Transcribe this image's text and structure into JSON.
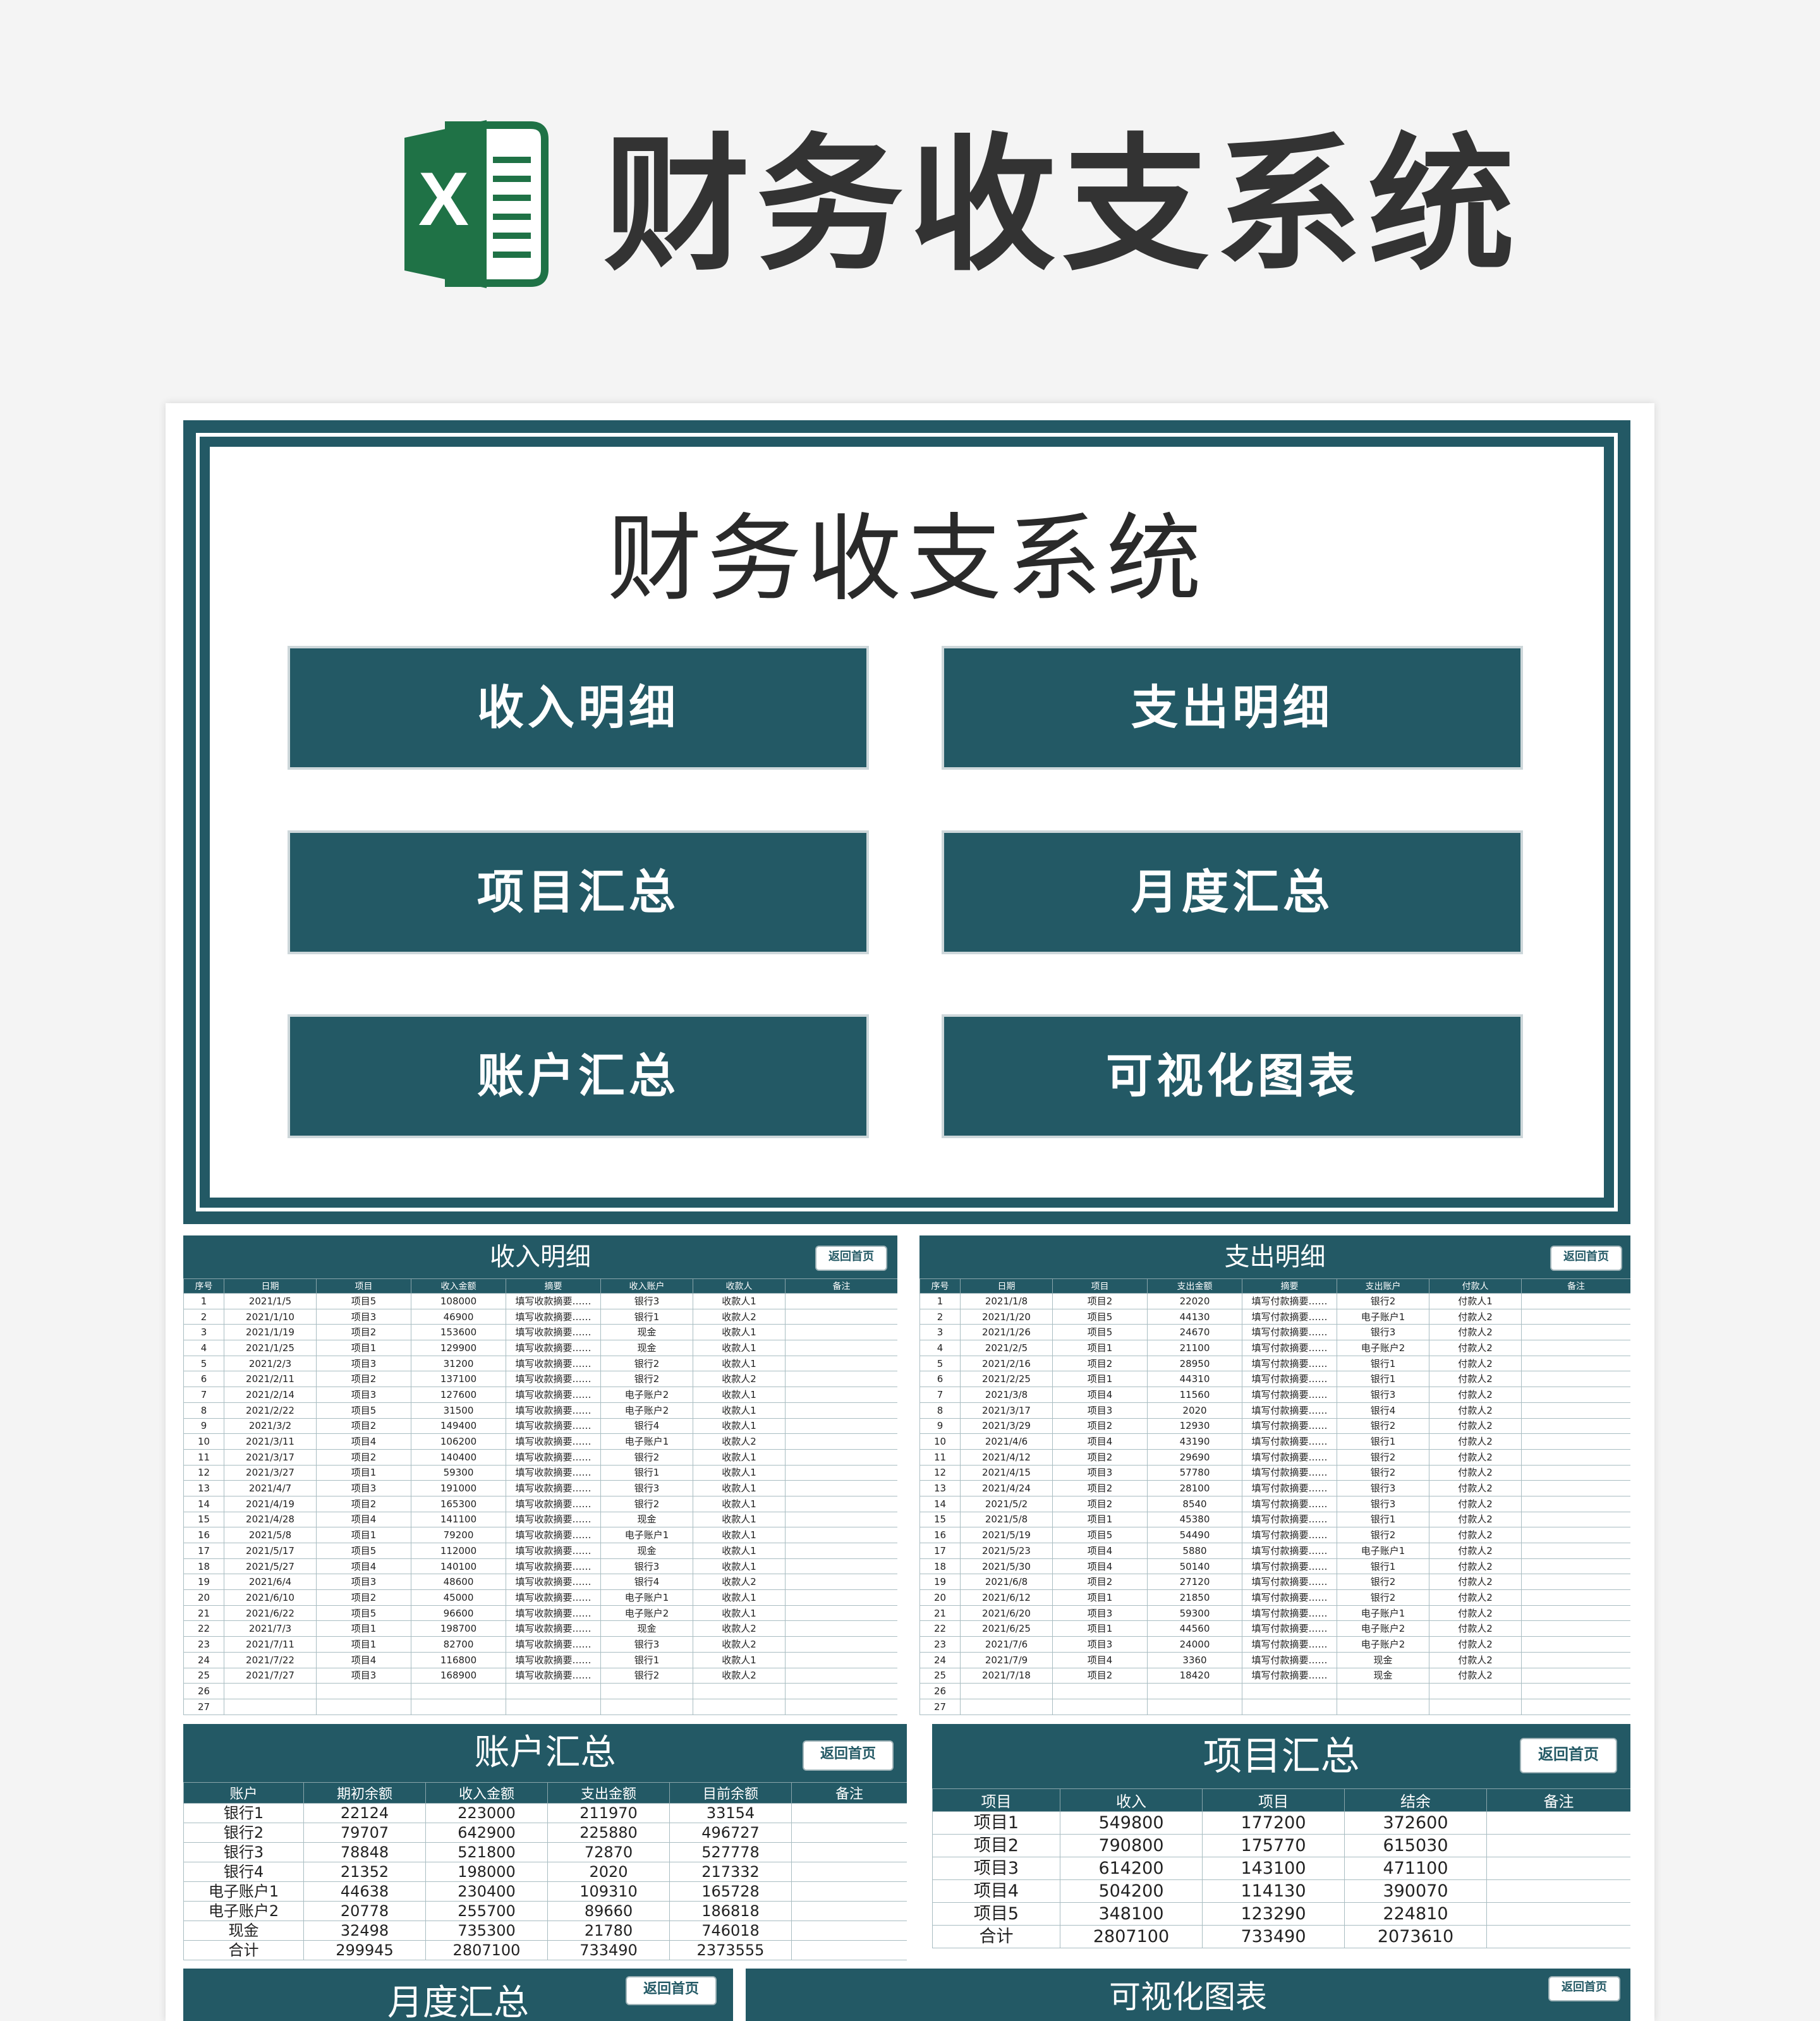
{
  "header": {
    "title": "财务收支系统",
    "logo_letter": "X"
  },
  "home": {
    "title": "财务收支系统",
    "buttons": {
      "income": "收入明细",
      "expense": "支出明细",
      "project": "项目汇总",
      "monthly": "月度汇总",
      "account": "账户汇总",
      "chart": "可视化图表"
    }
  },
  "back_label": "返回首页",
  "income": {
    "title": "收入明细",
    "columns": [
      "序号",
      "日期",
      "项目",
      "收入金额",
      "摘要",
      "收入账户",
      "收款人",
      "备注"
    ],
    "rows": [
      [
        "1",
        "2021/1/5",
        "项目5",
        "108000",
        "填写收款摘要……",
        "银行3",
        "收款人1",
        ""
      ],
      [
        "2",
        "2021/1/10",
        "项目3",
        "46900",
        "填写收款摘要……",
        "银行1",
        "收款人2",
        ""
      ],
      [
        "3",
        "2021/1/19",
        "项目2",
        "153600",
        "填写收款摘要……",
        "现金",
        "收款人1",
        ""
      ],
      [
        "4",
        "2021/1/25",
        "项目1",
        "129900",
        "填写收款摘要……",
        "现金",
        "收款人1",
        ""
      ],
      [
        "5",
        "2021/2/3",
        "项目3",
        "31200",
        "填写收款摘要……",
        "银行2",
        "收款人1",
        ""
      ],
      [
        "6",
        "2021/2/11",
        "项目2",
        "137100",
        "填写收款摘要……",
        "银行2",
        "收款人2",
        ""
      ],
      [
        "7",
        "2021/2/14",
        "项目3",
        "127600",
        "填写收款摘要……",
        "电子账户2",
        "收款人1",
        ""
      ],
      [
        "8",
        "2021/2/22",
        "项目5",
        "31500",
        "填写收款摘要……",
        "电子账户2",
        "收款人1",
        ""
      ],
      [
        "9",
        "2021/3/2",
        "项目2",
        "149400",
        "填写收款摘要……",
        "银行4",
        "收款人1",
        ""
      ],
      [
        "10",
        "2021/3/11",
        "项目4",
        "106200",
        "填写收款摘要……",
        "电子账户1",
        "收款人2",
        ""
      ],
      [
        "11",
        "2021/3/17",
        "项目2",
        "140400",
        "填写收款摘要……",
        "银行2",
        "收款人1",
        ""
      ],
      [
        "12",
        "2021/3/27",
        "项目1",
        "59300",
        "填写收款摘要……",
        "银行1",
        "收款人1",
        ""
      ],
      [
        "13",
        "2021/4/7",
        "项目3",
        "191000",
        "填写收款摘要……",
        "银行3",
        "收款人1",
        ""
      ],
      [
        "14",
        "2021/4/19",
        "项目2",
        "165300",
        "填写收款摘要……",
        "银行2",
        "收款人1",
        ""
      ],
      [
        "15",
        "2021/4/28",
        "项目4",
        "141100",
        "填写收款摘要……",
        "现金",
        "收款人1",
        ""
      ],
      [
        "16",
        "2021/5/8",
        "项目1",
        "79200",
        "填写收款摘要……",
        "电子账户1",
        "收款人1",
        ""
      ],
      [
        "17",
        "2021/5/17",
        "项目5",
        "112000",
        "填写收款摘要……",
        "现金",
        "收款人1",
        ""
      ],
      [
        "18",
        "2021/5/27",
        "项目4",
        "140100",
        "填写收款摘要……",
        "银行3",
        "收款人1",
        ""
      ],
      [
        "19",
        "2021/6/4",
        "项目3",
        "48600",
        "填写收款摘要……",
        "银行4",
        "收款人2",
        ""
      ],
      [
        "20",
        "2021/6/10",
        "项目2",
        "45000",
        "填写收款摘要……",
        "电子账户1",
        "收款人1",
        ""
      ],
      [
        "21",
        "2021/6/22",
        "项目5",
        "96600",
        "填写收款摘要……",
        "电子账户2",
        "收款人1",
        ""
      ],
      [
        "22",
        "2021/7/3",
        "项目1",
        "198700",
        "填写收款摘要……",
        "现金",
        "收款人2",
        ""
      ],
      [
        "23",
        "2021/7/11",
        "项目1",
        "82700",
        "填写收款摘要……",
        "银行3",
        "收款人2",
        ""
      ],
      [
        "24",
        "2021/7/22",
        "项目4",
        "116800",
        "填写收款摘要……",
        "银行1",
        "收款人1",
        ""
      ],
      [
        "25",
        "2021/7/27",
        "项目3",
        "168900",
        "填写收款摘要……",
        "银行2",
        "收款人2",
        ""
      ],
      [
        "26",
        "",
        "",
        "",
        "",
        "",
        "",
        ""
      ],
      [
        "27",
        "",
        "",
        "",
        "",
        "",
        "",
        ""
      ]
    ]
  },
  "expense": {
    "title": "支出明细",
    "columns": [
      "序号",
      "日期",
      "项目",
      "支出金额",
      "摘要",
      "支出账户",
      "付款人",
      "备注"
    ],
    "rows": [
      [
        "1",
        "2021/1/8",
        "项目2",
        "22020",
        "填写付款摘要……",
        "银行2",
        "付款人1",
        ""
      ],
      [
        "2",
        "2021/1/20",
        "项目5",
        "44130",
        "填写付款摘要……",
        "电子账户1",
        "付款人2",
        ""
      ],
      [
        "3",
        "2021/1/26",
        "项目5",
        "24670",
        "填写付款摘要……",
        "银行3",
        "付款人2",
        ""
      ],
      [
        "4",
        "2021/2/5",
        "项目1",
        "21100",
        "填写付款摘要……",
        "电子账户2",
        "付款人2",
        ""
      ],
      [
        "5",
        "2021/2/16",
        "项目2",
        "28950",
        "填写付款摘要……",
        "银行1",
        "付款人2",
        ""
      ],
      [
        "6",
        "2021/2/25",
        "项目1",
        "44310",
        "填写付款摘要……",
        "银行1",
        "付款人2",
        ""
      ],
      [
        "7",
        "2021/3/8",
        "项目4",
        "11560",
        "填写付款摘要……",
        "银行3",
        "付款人2",
        ""
      ],
      [
        "8",
        "2021/3/17",
        "项目3",
        "2020",
        "填写付款摘要……",
        "银行4",
        "付款人2",
        ""
      ],
      [
        "9",
        "2021/3/29",
        "项目2",
        "12930",
        "填写付款摘要……",
        "银行2",
        "付款人2",
        ""
      ],
      [
        "10",
        "2021/4/6",
        "项目4",
        "43190",
        "填写付款摘要……",
        "银行1",
        "付款人2",
        ""
      ],
      [
        "11",
        "2021/4/12",
        "项目2",
        "29690",
        "填写付款摘要……",
        "银行2",
        "付款人2",
        ""
      ],
      [
        "12",
        "2021/4/15",
        "项目3",
        "57780",
        "填写付款摘要……",
        "银行2",
        "付款人2",
        ""
      ],
      [
        "13",
        "2021/4/24",
        "项目2",
        "28100",
        "填写付款摘要……",
        "银行3",
        "付款人2",
        ""
      ],
      [
        "14",
        "2021/5/2",
        "项目2",
        "8540",
        "填写付款摘要……",
        "银行3",
        "付款人2",
        ""
      ],
      [
        "15",
        "2021/5/8",
        "项目1",
        "45380",
        "填写付款摘要……",
        "银行1",
        "付款人2",
        ""
      ],
      [
        "16",
        "2021/5/19",
        "项目5",
        "54490",
        "填写付款摘要……",
        "银行2",
        "付款人2",
        ""
      ],
      [
        "17",
        "2021/5/23",
        "项目4",
        "5880",
        "填写付款摘要……",
        "电子账户1",
        "付款人2",
        ""
      ],
      [
        "18",
        "2021/5/30",
        "项目4",
        "50140",
        "填写付款摘要……",
        "银行1",
        "付款人2",
        ""
      ],
      [
        "19",
        "2021/6/8",
        "项目2",
        "27120",
        "填写付款摘要……",
        "银行2",
        "付款人2",
        ""
      ],
      [
        "20",
        "2021/6/12",
        "项目1",
        "21850",
        "填写付款摘要……",
        "银行2",
        "付款人2",
        ""
      ],
      [
        "21",
        "2021/6/20",
        "项目3",
        "59300",
        "填写付款摘要……",
        "电子账户1",
        "付款人2",
        ""
      ],
      [
        "22",
        "2021/6/25",
        "项目1",
        "44560",
        "填写付款摘要……",
        "电子账户2",
        "付款人2",
        ""
      ],
      [
        "23",
        "2021/7/6",
        "项目3",
        "24000",
        "填写付款摘要……",
        "电子账户2",
        "付款人2",
        ""
      ],
      [
        "24",
        "2021/7/9",
        "项目4",
        "3360",
        "填写付款摘要……",
        "现金",
        "付款人2",
        ""
      ],
      [
        "25",
        "2021/7/18",
        "项目2",
        "18420",
        "填写付款摘要……",
        "现金",
        "付款人2",
        ""
      ],
      [
        "26",
        "",
        "",
        "",
        "",
        "",
        "",
        ""
      ],
      [
        "27",
        "",
        "",
        "",
        "",
        "",
        "",
        ""
      ]
    ]
  },
  "account": {
    "title": "账户汇总",
    "columns": [
      "账户",
      "期初余额",
      "收入金额",
      "支出金额",
      "目前余额",
      "备注"
    ],
    "rows": [
      [
        "银行1",
        "22124",
        "223000",
        "211970",
        "33154",
        ""
      ],
      [
        "银行2",
        "79707",
        "642900",
        "225880",
        "496727",
        ""
      ],
      [
        "银行3",
        "78848",
        "521800",
        "72870",
        "527778",
        ""
      ],
      [
        "银行4",
        "21352",
        "198000",
        "2020",
        "217332",
        ""
      ],
      [
        "电子账户1",
        "44638",
        "230400",
        "109310",
        "165728",
        ""
      ],
      [
        "电子账户2",
        "20778",
        "255700",
        "89660",
        "186818",
        ""
      ],
      [
        "现金",
        "32498",
        "735300",
        "21780",
        "746018",
        ""
      ],
      [
        "合计",
        "299945",
        "2807100",
        "733490",
        "2373555",
        ""
      ]
    ]
  },
  "project": {
    "title": "项目汇总",
    "columns": [
      "项目",
      "收入",
      "项目",
      "结余",
      "备注"
    ],
    "rows": [
      [
        "项目1",
        "549800",
        "177200",
        "372600",
        ""
      ],
      [
        "项目2",
        "790800",
        "175770",
        "615030",
        ""
      ],
      [
        "项目3",
        "614200",
        "143100",
        "471100",
        ""
      ],
      [
        "项目4",
        "504200",
        "114130",
        "390070",
        ""
      ],
      [
        "项目5",
        "348100",
        "123290",
        "224810",
        ""
      ],
      [
        "合计",
        "2807100",
        "733490",
        "2073610",
        ""
      ]
    ]
  },
  "monthly": {
    "title": "月度汇总"
  },
  "chart": {
    "title": "可视化图表"
  }
}
